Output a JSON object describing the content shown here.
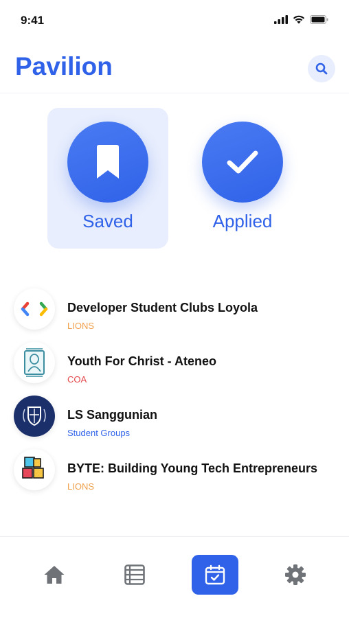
{
  "status_bar": {
    "time": "9:41"
  },
  "header": {
    "title": "Pavilion"
  },
  "categories": [
    {
      "label": "Saved",
      "icon": "bookmark-icon",
      "selected": true
    },
    {
      "label": "Applied",
      "icon": "checkmark-icon",
      "selected": false
    }
  ],
  "organizations": [
    {
      "name": "Developer Student Clubs Loyola",
      "tag": "LIONS",
      "tag_color": "#f0a04b"
    },
    {
      "name": "Youth For Christ - Ateneo",
      "tag": "COA",
      "tag_color": "#e5484d"
    },
    {
      "name": "LS Sanggunian",
      "tag": "Student Groups",
      "tag_color": "#2f62e8"
    },
    {
      "name": "BYTE: Building Young Tech Entrepreneurs",
      "tag": "LIONS",
      "tag_color": "#f0a04b"
    }
  ],
  "bottom_nav": [
    {
      "icon": "home-icon",
      "active": false
    },
    {
      "icon": "list-icon",
      "active": false
    },
    {
      "icon": "calendar-check-icon",
      "active": true
    },
    {
      "icon": "gear-icon",
      "active": false
    }
  ],
  "colors": {
    "accent": "#2f62e8",
    "accent_light": "#e8eefd"
  }
}
